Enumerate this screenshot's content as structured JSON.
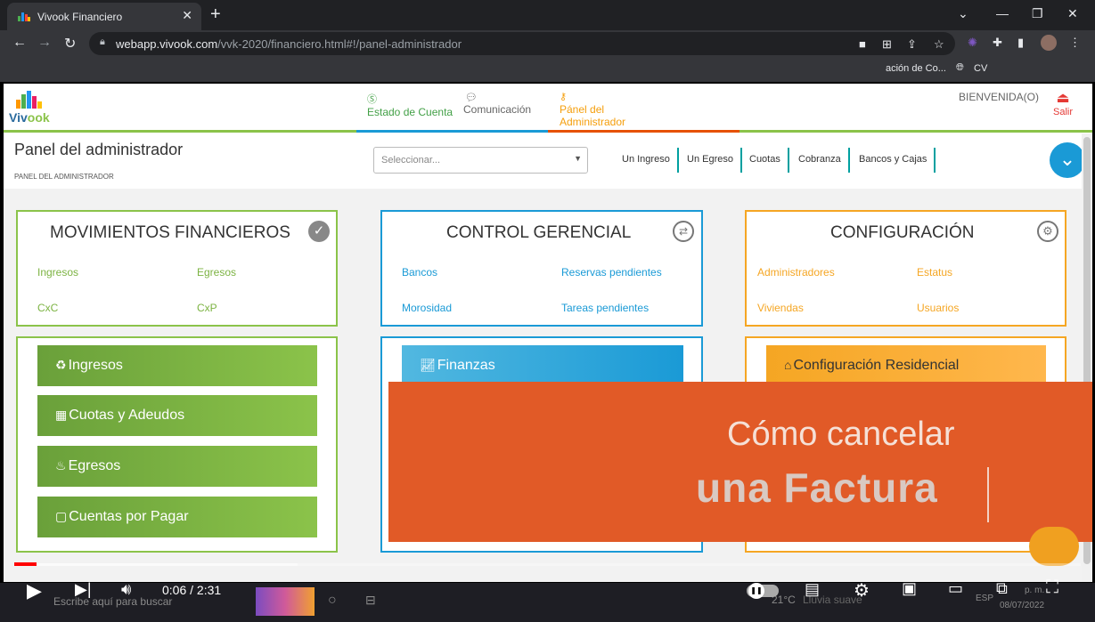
{
  "browser": {
    "tab_title": "Vivook Financiero",
    "url_host": "webapp.vivook.com",
    "url_path": "/vvk-2020/financiero.html#!/panel-administrador",
    "bookmarks": [
      "ación de Co...",
      "CV"
    ]
  },
  "app": {
    "logo_text_a": "Viv",
    "logo_text_b": "ook",
    "nav": {
      "estado": "Estado de Cuenta",
      "comunicacion": "Comunicación",
      "panel_l1": "Pánel del",
      "panel_l2": "Administrador"
    },
    "welcome": "BIENVENIDA(O)",
    "logout": "Salir",
    "panel_title": "Panel del administrador",
    "panel_sub": "PANEL DEL ADMINISTRADOR",
    "select_placeholder": "Seleccionar...",
    "quick_links": [
      "Un Ingreso",
      "Un Egreso",
      "Cuotas",
      "Cobranza",
      "Bancos y Cajas"
    ]
  },
  "cards": {
    "movimientos": {
      "title": "MOVIMIENTOS FINANCIEROS",
      "links": [
        "Ingresos",
        "Egresos",
        "CxC",
        "CxP"
      ]
    },
    "control": {
      "title": "CONTROL GERENCIAL",
      "links": [
        "Bancos",
        "Reservas pendientes",
        "Morosidad",
        "Tareas pendientes"
      ]
    },
    "config": {
      "title": "CONFIGURACIÓN",
      "links": [
        "Administradores",
        "Estatus",
        "Viviendas",
        "Usuarios"
      ]
    }
  },
  "buttons": {
    "ingresos": "Ingresos",
    "cuotas": "Cuotas y Adeudos",
    "egresos": "Egresos",
    "cuentas": "Cuentas por Pagar",
    "finanzas": "Finanzas",
    "residencial": "Configuración Residencial"
  },
  "banner": {
    "line1": "Cómo cancelar",
    "line2": "una Factura"
  },
  "player": {
    "time": "0:06 / 2:31",
    "progress_fraction": 0.021
  },
  "taskbar": {
    "search_placeholder": "Escribe aquí para buscar",
    "weather": "21°C",
    "weather_desc": "Lluvia suave",
    "lang": "ESP",
    "clock": "p. m.",
    "date": "08/07/2022"
  },
  "colors": {
    "green": "#8bc34a",
    "blue": "#1a9ad6",
    "orange": "#f5a623",
    "banner": "#e15a27"
  }
}
